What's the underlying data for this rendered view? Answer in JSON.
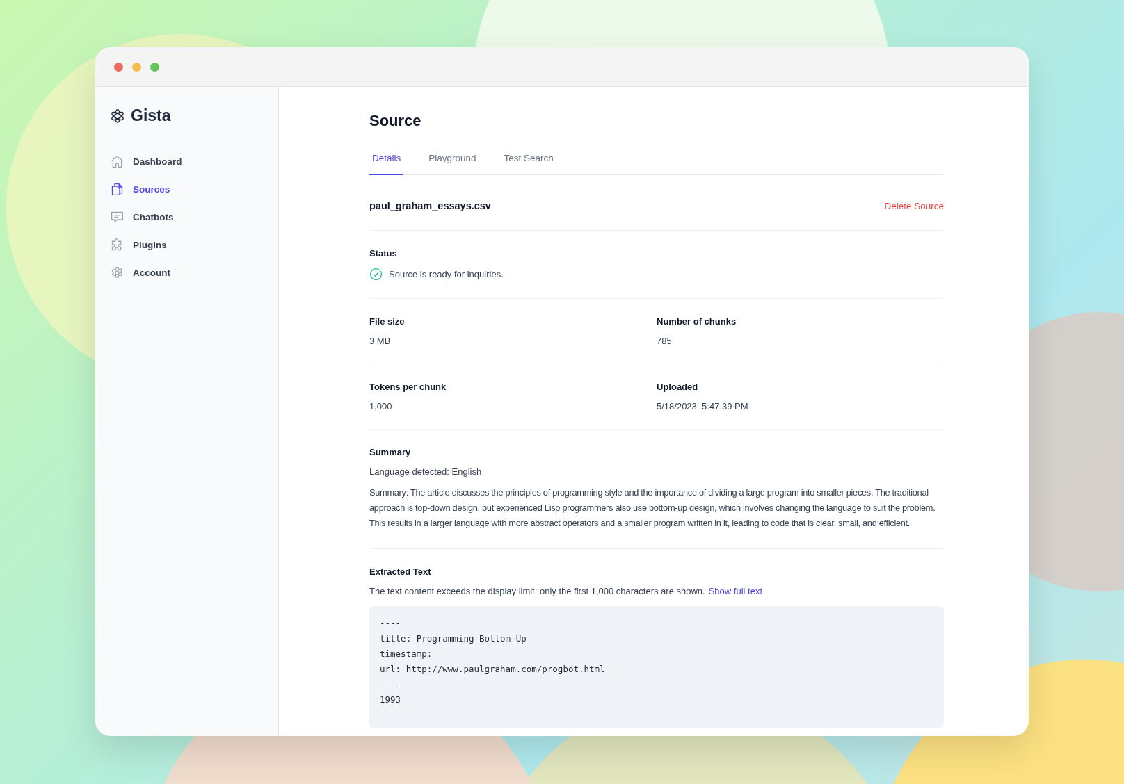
{
  "app": {
    "name": "Gista"
  },
  "sidebar": {
    "items": [
      {
        "label": "Dashboard",
        "selected": false
      },
      {
        "label": "Sources",
        "selected": true
      },
      {
        "label": "Chatbots",
        "selected": false
      },
      {
        "label": "Plugins",
        "selected": false
      },
      {
        "label": "Account",
        "selected": false
      }
    ]
  },
  "page": {
    "title": "Source",
    "tabs": [
      {
        "label": "Details",
        "selected": true
      },
      {
        "label": "Playground",
        "selected": false
      },
      {
        "label": "Test Search",
        "selected": false
      }
    ],
    "file_name": "paul_graham_essays.csv",
    "delete_link": "Delete Source",
    "status": {
      "label": "Status",
      "text": "Source is ready for inquiries.",
      "ready": true
    },
    "facts": [
      [
        {
          "label": "File size",
          "value": "3 MB"
        },
        {
          "label": "Number of chunks",
          "value": "785"
        }
      ],
      [
        {
          "label": "Tokens per chunk",
          "value": "1,000"
        },
        {
          "label": "Uploaded",
          "value": "5/18/2023, 5:47:39 PM"
        }
      ]
    ],
    "summary": {
      "label": "Summary",
      "language": "Language detected: English",
      "text": "Summary: The article discusses the principles of programming style and the importance of dividing a large program into smaller pieces. The traditional approach is top-down design, but experienced Lisp programmers also use bottom-up design, which involves changing the language to suit the problem. This results in a larger language with more abstract operators and a smaller program written in it, leading to code that is clear, small, and efficient."
    },
    "extracted": {
      "label": "Extracted Text",
      "note": "The text content exceeds the display limit; only the first 1,000 characters are shown.",
      "link": "Show full text",
      "lines": [
        "----",
        "title: Programming Bottom-Up",
        "timestamp:",
        "url: http://www.paulgraham.com/progbot.html",
        "----",
        "1993"
      ]
    }
  }
}
